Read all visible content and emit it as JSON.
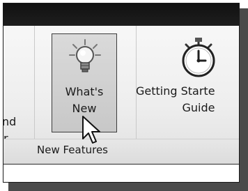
{
  "ribbon": {
    "left_partial_button": {
      "line1": "nd",
      "line2": "r"
    },
    "whats_new_button": {
      "line1": "What's",
      "line2": "New",
      "icon": "lightbulb-icon"
    },
    "getting_started_button": {
      "line1": "Getting Starte",
      "line2": "Guide",
      "icon": "stopwatch-icon"
    },
    "group_label": "New Features"
  },
  "colors": {
    "titlebar": "#111111",
    "selected_button_bg": "#c8c8c8"
  }
}
